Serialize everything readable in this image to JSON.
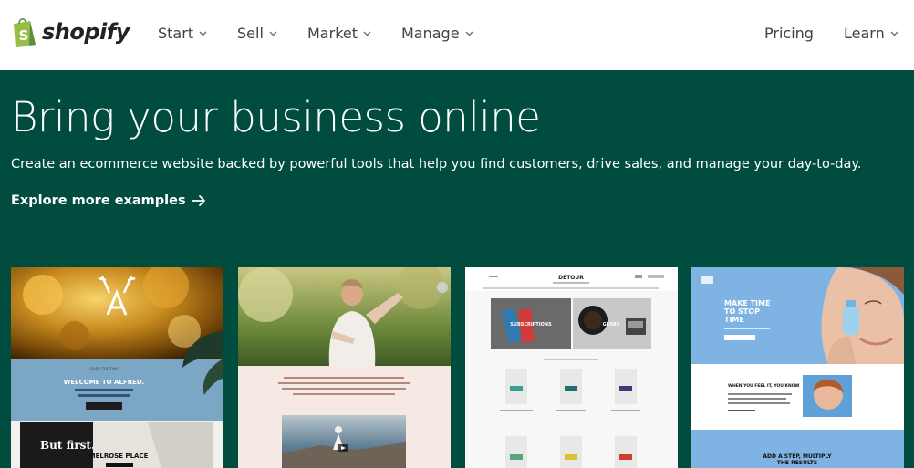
{
  "nav": {
    "logo_text": "shopify",
    "items": [
      {
        "label": "Start"
      },
      {
        "label": "Sell"
      },
      {
        "label": "Market"
      },
      {
        "label": "Manage"
      }
    ],
    "pricing": "Pricing",
    "learn": "Learn"
  },
  "hero": {
    "title": "Bring your business online",
    "subtitle": "Create an ecommerce website backed by powerful tools that help you find customers, drive sales, and manage your day-to-day.",
    "explore": "Explore more examples"
  },
  "cards": {
    "alfred": {
      "welcome": "WELCOME TO ALFRED.",
      "small_text": "SHOP THE FAM",
      "but_first": "But first.",
      "melrose": "MELROSE PLACE"
    },
    "detour": {
      "brand": "DETOUR",
      "subscriptions": "SUBSCRIPTIONS",
      "gears": "GEARS"
    },
    "beauty": {
      "headline_1": "MAKE TIME",
      "headline_2": "TO STOP",
      "headline_3": "TIME",
      "when_title": "WHEN YOU FEEL IT, YOU KNOW",
      "footer_1": "ADD A STEP, MULTIPLY",
      "footer_2": "THE RESULTS"
    }
  },
  "colors": {
    "hero_bg": "#004c3f",
    "nav_bg": "#ffffff",
    "brand_green": "#95bf47"
  }
}
